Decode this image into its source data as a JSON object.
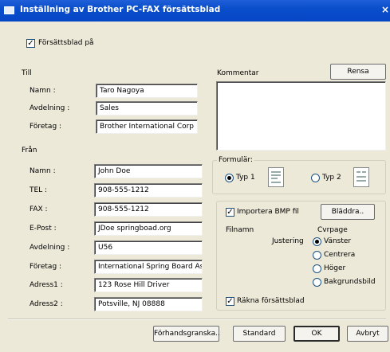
{
  "window": {
    "title": "Inställning av Brother PC-FAX försättsblad",
    "close_glyph": "×"
  },
  "cover_on": {
    "label": "Försättsblad på",
    "checked": true
  },
  "to": {
    "heading": "Till",
    "name": {
      "label": "Namn :",
      "value": "Taro Nagoya"
    },
    "department": {
      "label": "Avdelning :",
      "value": "Sales"
    },
    "company": {
      "label": "Företag :",
      "value": "Brother International Corp"
    }
  },
  "from": {
    "heading": "Från",
    "name": {
      "label": "Namn :",
      "value": "John Doe"
    },
    "tel": {
      "label": "TEL :",
      "value": "908-555-1212"
    },
    "fax": {
      "label": "FAX :",
      "value": "908-555-1212"
    },
    "email": {
      "label": "E-Post :",
      "value": "JDoe springboad.org"
    },
    "department": {
      "label": "Avdelning :",
      "value": "U56"
    },
    "company": {
      "label": "Företag :",
      "value": "International Spring Board Ass"
    },
    "address1": {
      "label": "Adress1 :",
      "value": "123 Rose Hill Driver"
    },
    "address2": {
      "label": "Adress2 :",
      "value": "Potsville, NJ 08888"
    }
  },
  "comment": {
    "heading": "Kommentar",
    "clear_label": "Rensa",
    "value": ""
  },
  "form": {
    "heading": "Formulär:",
    "type1": {
      "label": "Typ 1",
      "selected": true
    },
    "type2": {
      "label": "Typ 2",
      "selected": false
    }
  },
  "bmp": {
    "import_label": "Importera BMP fil",
    "import_checked": true,
    "browse_label": "Bläddra..",
    "filename_label": "Filnamn",
    "cvrpage_label": "Cvrpage",
    "alignment_label": "Justering",
    "options": [
      "Vänster",
      "Centrera",
      "Höger",
      "Bakgrundsbild"
    ],
    "selected_option": "Vänster"
  },
  "count_cover": {
    "label": "Räkna försättsblad",
    "checked": true
  },
  "footer": {
    "preview_label": "Förhandsgranska..",
    "standard_label": "Standard",
    "ok_label": "OK",
    "cancel_label": "Avbryt"
  }
}
